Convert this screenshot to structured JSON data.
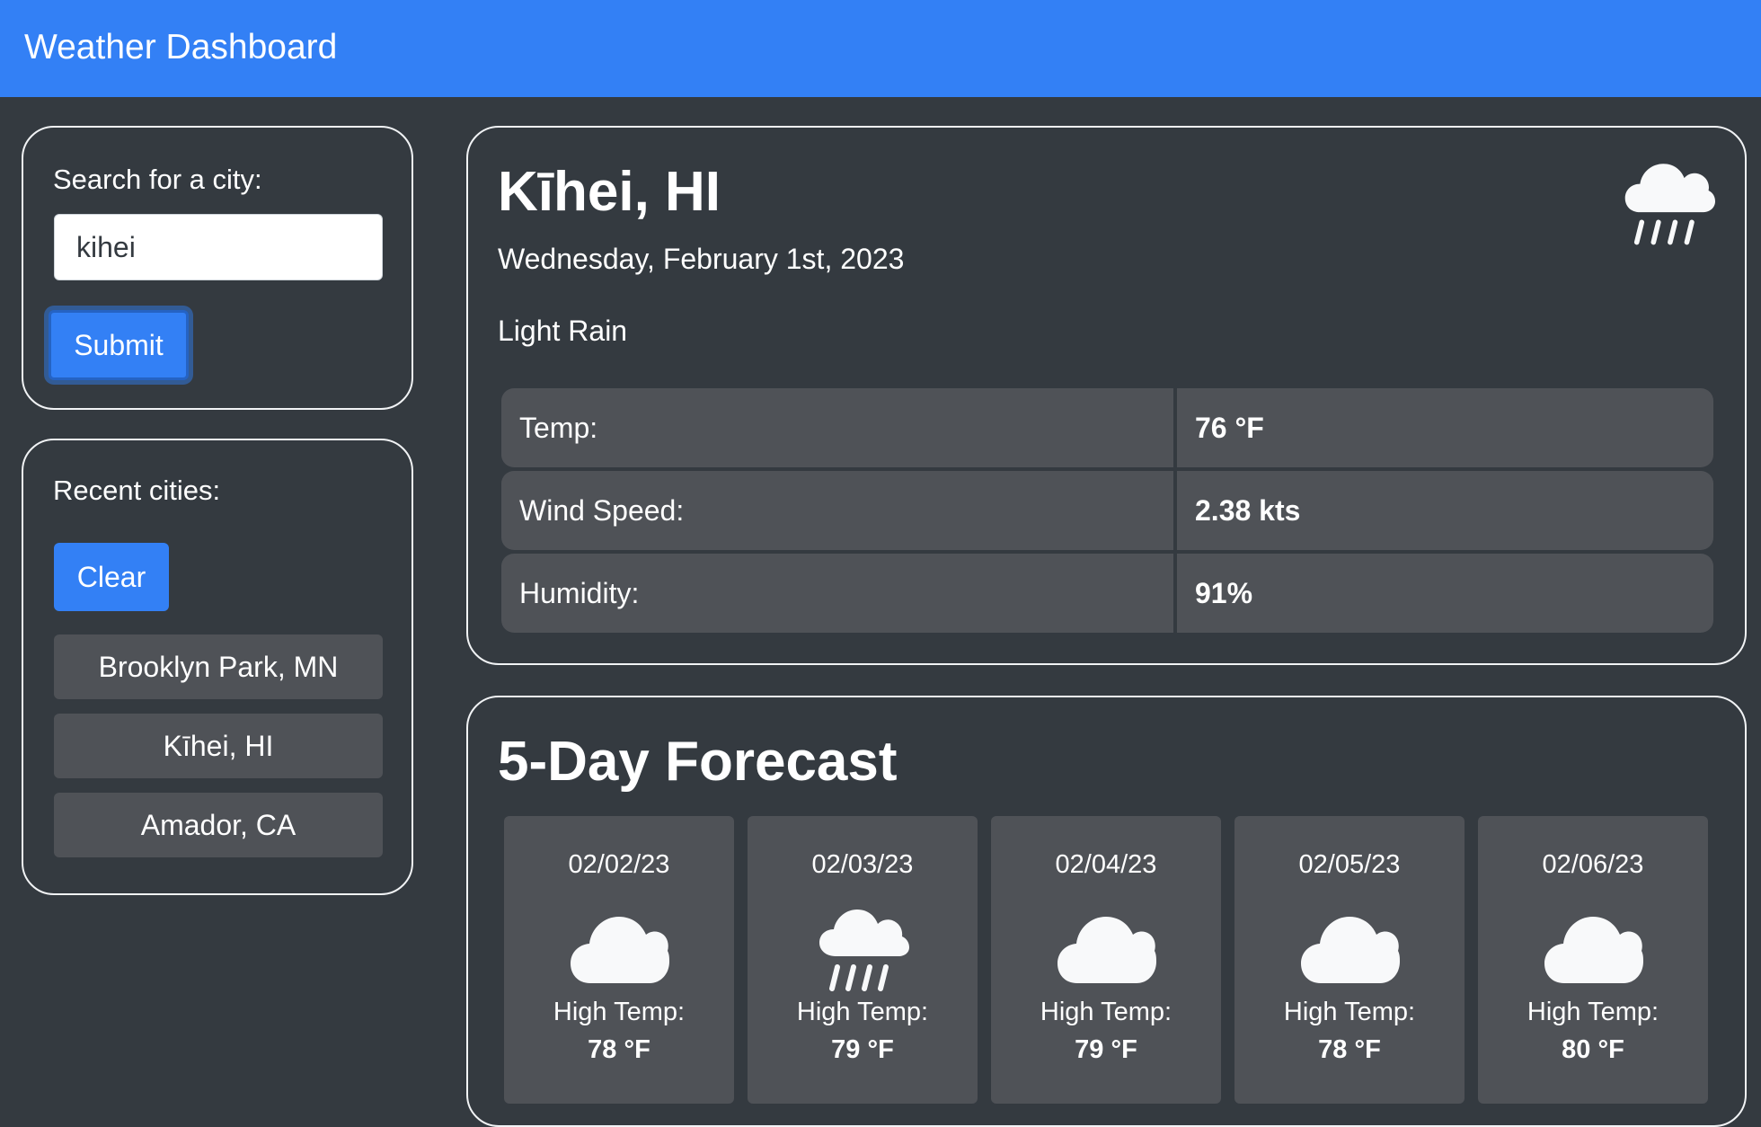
{
  "navbar": {
    "brand": "Weather Dashboard"
  },
  "search": {
    "label": "Search for a city:",
    "value": "kihei",
    "submit_label": "Submit"
  },
  "recent": {
    "label": "Recent cities:",
    "clear_label": "Clear",
    "cities": [
      "Brooklyn Park, MN",
      "Kīhei, HI",
      "Amador, CA"
    ]
  },
  "current": {
    "city": "Kīhei, HI",
    "date": "Wednesday, February 1st, 2023",
    "condition": "Light Rain",
    "icon": "rain-cloud-icon",
    "stats": [
      {
        "label": "Temp:",
        "value": "76 °F"
      },
      {
        "label": "Wind Speed:",
        "value": "2.38 kts"
      },
      {
        "label": "Humidity:",
        "value": "91%"
      }
    ]
  },
  "forecast": {
    "title": "5-Day Forecast",
    "days": [
      {
        "date": "02/02/23",
        "icon": "cloud-icon",
        "high_label": "High Temp:",
        "high": "78 °F"
      },
      {
        "date": "02/03/23",
        "icon": "rain-cloud-icon",
        "high_label": "High Temp:",
        "high": "79 °F"
      },
      {
        "date": "02/04/23",
        "icon": "cloud-icon",
        "high_label": "High Temp:",
        "high": "79 °F"
      },
      {
        "date": "02/05/23",
        "icon": "cloud-icon",
        "high_label": "High Temp:",
        "high": "78 °F"
      },
      {
        "date": "02/06/23",
        "icon": "cloud-icon",
        "high_label": "High Temp:",
        "high": "80 °F"
      }
    ]
  },
  "colors": {
    "navbar": "#3380f5",
    "background": "#343a40",
    "card": "#4f5257",
    "accent": "#3380f5"
  }
}
